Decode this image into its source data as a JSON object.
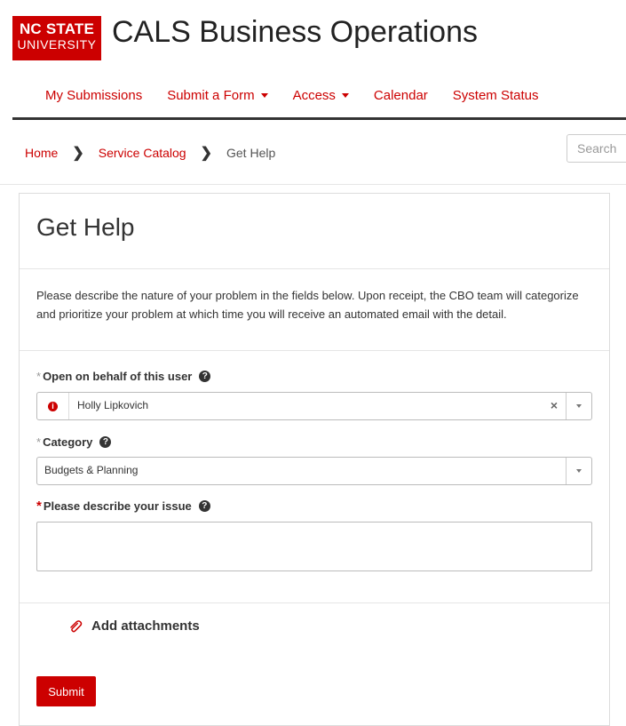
{
  "brand": {
    "logo_line1": "NC STATE",
    "logo_line2": "UNIVERSITY",
    "site_title": "CALS Business Operations",
    "accent": "#cc0000"
  },
  "nav": {
    "items": [
      {
        "label": "My Submissions",
        "dropdown": false
      },
      {
        "label": "Submit a Form",
        "dropdown": true
      },
      {
        "label": "Access",
        "dropdown": true
      },
      {
        "label": "Calendar",
        "dropdown": false
      },
      {
        "label": "System Status",
        "dropdown": false
      }
    ]
  },
  "breadcrumb": {
    "home": "Home",
    "catalog": "Service Catalog",
    "current": "Get Help"
  },
  "search": {
    "placeholder": "Search"
  },
  "form": {
    "title": "Get Help",
    "intro": "Please describe the nature of your problem in the fields below. Upon receipt, the CBO team will categorize and prioritize your problem at which time you will receive an automated email with the detail.",
    "behalf_label": "Open on behalf of this user",
    "behalf_value": "Holly Lipkovich",
    "category_label": "Category",
    "category_value": "Budgets & Planning",
    "issue_label": "Please describe your issue",
    "attachments_label": "Add attachments",
    "submit_label": "Submit"
  },
  "icons": {
    "required_marker": "*",
    "help": "question-circle-icon",
    "info": "info-circle-icon",
    "clear": "times-icon",
    "attach": "paperclip-icon",
    "breadcrumb_sep": "chevron-right-icon"
  }
}
